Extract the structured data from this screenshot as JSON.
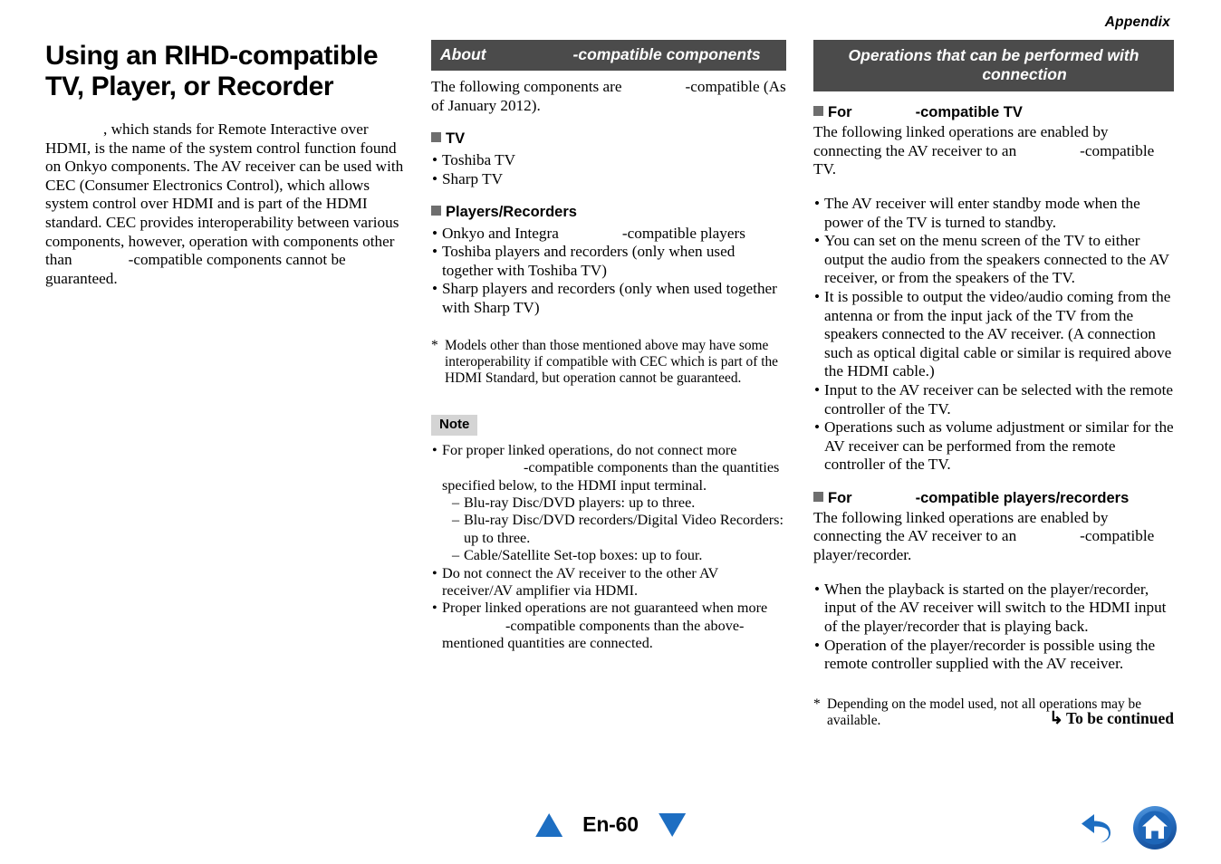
{
  "running_head": "Appendix",
  "left_column": {
    "title": "Using an RIHD-compatible TV, Player, or Recorder",
    "intro_part1": ", which stands for Remote Interactive over HDMI, is the name of the system control function found on Onkyo components. The AV receiver can be used with CEC (Consumer Electronics Control), which allows system control over HDMI and is part of the HDMI standard. CEC provides interoperability between various components, however, operation with components other than",
    "intro_part2": "-compatible components cannot be guaranteed."
  },
  "middle_column": {
    "header_text_1": "About",
    "header_text_2": "-compatible components",
    "intro_1": "The following components are",
    "intro_2": "-compatible (As of January 2012).",
    "tv_heading": "TV",
    "tv_items": [
      "Toshiba TV",
      "Sharp TV"
    ],
    "players_heading": "Players/Recorders",
    "players_items_1": "Onkyo and Integra",
    "players_items_1b": "-compatible players",
    "players_items": [
      "Toshiba players and recorders (only when used together with Toshiba TV)",
      "Sharp players and recorders (only when used together with Sharp TV)"
    ],
    "footnote_marker": "*",
    "footnote": "Models other than those mentioned above may have some interoperability if compatible with CEC which is part of the HDMI Standard, but operation cannot be guaranteed.",
    "note_label": "Note",
    "note_item_1a": "For proper linked operations, do not connect more",
    "note_item_1b": "-compatible components than the quantities specified below, to the HDMI input terminal.",
    "note_sub_items": [
      "Blu-ray Disc/DVD players: up to three.",
      "Blu-ray Disc/DVD recorders/Digital Video Recorders: up to three.",
      "Cable/Satellite Set-top boxes: up to four."
    ],
    "note_item_2": "Do not connect the AV receiver to the other AV receiver/AV amplifier via HDMI.",
    "note_item_3a": "Proper linked operations are not guaranteed when more",
    "note_item_3b": "-compatible components than the above-mentioned quantities are connected."
  },
  "right_column": {
    "header_line_1": "Operations that can be performed with",
    "header_line_2": "connection",
    "tv_heading_1": "For",
    "tv_heading_2": "-compatible TV",
    "tv_intro_1": "The following linked operations are enabled by connecting the AV receiver to an",
    "tv_intro_2": "-compatible TV.",
    "tv_items": [
      "The AV receiver will enter standby mode when the power of the TV is turned to standby.",
      "You can set on the menu screen of the TV to either output the audio from the speakers connected to the AV receiver, or from the speakers of the TV.",
      "It is possible to output the video/audio coming from the antenna or from the input jack of the TV from the speakers connected to the AV receiver. (A connection such as optical digital cable or similar is required above the HDMI cable.)",
      "Input to the AV receiver can be selected with the remote controller of the TV.",
      "Operations such as volume adjustment or similar for the AV receiver can be performed from the remote controller of the TV."
    ],
    "players_heading_1": "For",
    "players_heading_2": "-compatible players/recorders",
    "players_intro_1": "The following linked operations are enabled by connecting the AV receiver to an",
    "players_intro_2": "-compatible player/recorder.",
    "players_items": [
      "When the playback is started on the player/recorder, input of the AV receiver will switch to the HDMI input of the player/recorder that is playing back.",
      "Operation of the player/recorder is possible using the remote controller supplied with the AV receiver."
    ],
    "footnote_marker": "*",
    "footnote": "Depending on the model used, not all operations may be available."
  },
  "to_be_continued": {
    "arrow": "↳",
    "label": "To be continued"
  },
  "footer": {
    "page_label": "En-60",
    "prev_icon": "triangle-up-icon",
    "next_icon": "triangle-down-icon",
    "back_icon": "back-arrow-icon",
    "home_icon": "home-icon"
  },
  "colors": {
    "section_bar_bg": "#4b4b4b",
    "square_marker": "#6e6e6e",
    "note_badge_bg": "#d4d4d4",
    "nav_blue": "#1d6ec2"
  }
}
